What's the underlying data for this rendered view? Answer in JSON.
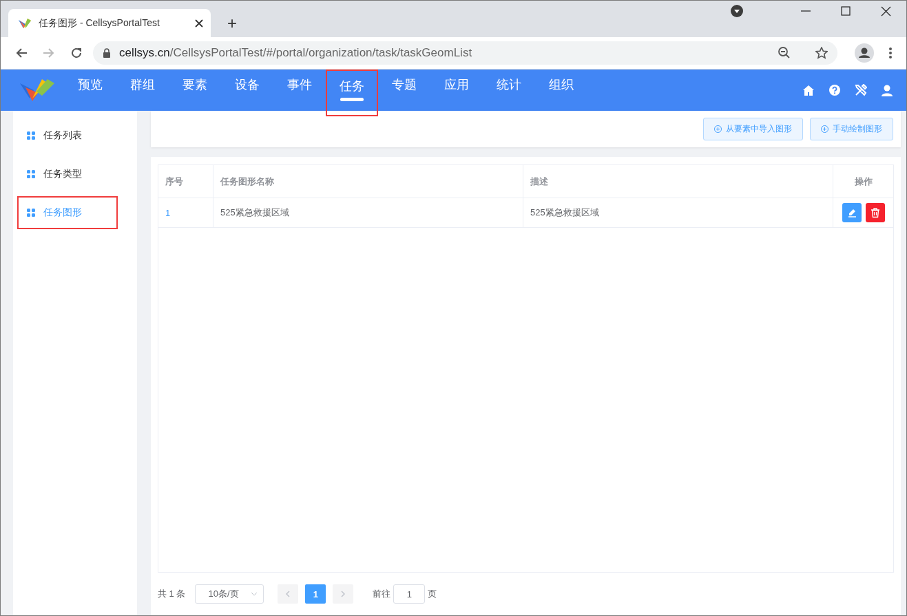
{
  "browser": {
    "tab_title": "任务图形 - CellsysPortalTest",
    "new_tab": "+",
    "url_host": "cellsys.cn",
    "url_path": "/CellsysPortalTest/#/portal/organization/task/taskGeomList"
  },
  "nav": {
    "items": [
      {
        "label": "预览",
        "selected": false,
        "highlighted": false
      },
      {
        "label": "群组",
        "selected": false,
        "highlighted": false
      },
      {
        "label": "要素",
        "selected": false,
        "highlighted": false
      },
      {
        "label": "设备",
        "selected": false,
        "highlighted": false
      },
      {
        "label": "事件",
        "selected": false,
        "highlighted": false
      },
      {
        "label": "任务",
        "selected": true,
        "highlighted": true
      },
      {
        "label": "专题",
        "selected": false,
        "highlighted": false
      },
      {
        "label": "应用",
        "selected": false,
        "highlighted": false
      },
      {
        "label": "统计",
        "selected": false,
        "highlighted": false
      },
      {
        "label": "组织",
        "selected": false,
        "highlighted": false
      }
    ]
  },
  "sidebar": {
    "items": [
      {
        "label": "任务列表",
        "selected": false,
        "highlighted": false
      },
      {
        "label": "任务类型",
        "selected": false,
        "highlighted": false
      },
      {
        "label": "任务图形",
        "selected": true,
        "highlighted": true
      }
    ]
  },
  "toolbar": {
    "buttons": [
      "从要素中导入图形",
      "手动绘制图形"
    ]
  },
  "table": {
    "columns": [
      "序号",
      "任务图形名称",
      "描述",
      "操作"
    ],
    "rows": [
      {
        "cells": [
          "1",
          "525紧急救援区域",
          "525紧急救援区域"
        ]
      }
    ]
  },
  "pagination": {
    "total": "共 1 条",
    "page_size": "10条/页",
    "pages": [
      {
        "label": "1",
        "selected": true
      }
    ],
    "goto_label": "前往",
    "goto_value": "1",
    "page_suffix": "页"
  }
}
